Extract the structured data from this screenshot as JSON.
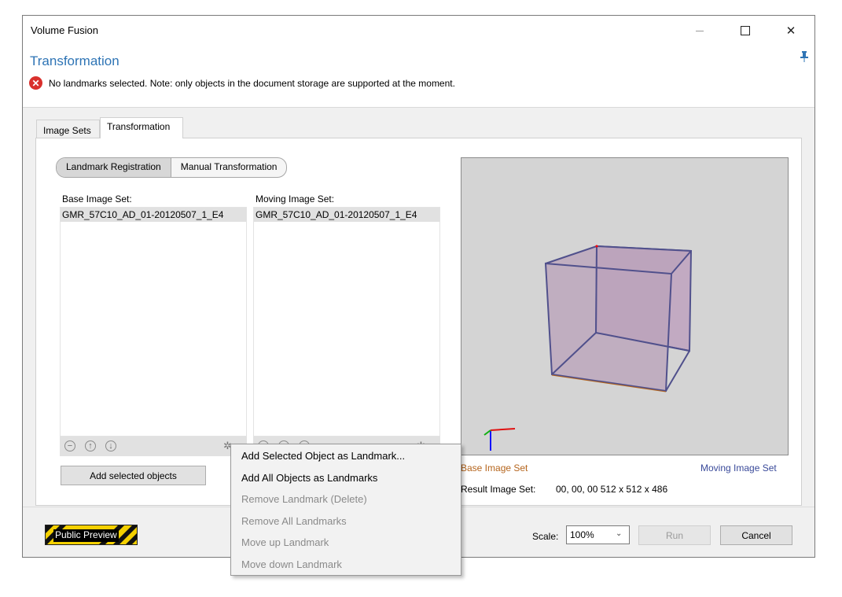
{
  "window": {
    "title": "Volume Fusion",
    "minimize_icon": "minimize-icon",
    "maximize_icon": "maximize-icon",
    "close_icon": "close-icon"
  },
  "header": {
    "title": "Transformation",
    "pin_icon": "pin-icon",
    "error_icon": "error-icon",
    "message": "No landmarks selected. Note: only objects in the document storage are supported at the moment."
  },
  "tabs": [
    {
      "label": "Image Sets",
      "active": false
    },
    {
      "label": "Transformation",
      "active": true
    }
  ],
  "mode_toggle": {
    "options": [
      "Landmark Registration",
      "Manual Transformation"
    ],
    "selected": "Landmark Registration"
  },
  "base": {
    "label": "Base Image Set:",
    "items": [
      "GMR_57C10_AD_01-20120507_1_E4"
    ]
  },
  "moving": {
    "label": "Moving Image Set:",
    "items": [
      "GMR_57C10_AD_01-20120507_1_E4"
    ]
  },
  "list_tools": {
    "remove_icon": "minus-circle-icon",
    "up_icon": "arrow-up-circle-icon",
    "down_icon": "arrow-down-circle-icon",
    "settings_icon": "gear-icon"
  },
  "add_selected_label": "Add selected objects",
  "viewport": {
    "base_label": "Base Image Set",
    "moving_label": "Moving Image Set",
    "result_label": "Result Image Set:",
    "result_value": "00, 00, 00  512 x 512 x 486",
    "base_color": "#b5651d",
    "moving_color": "#3a4a9a"
  },
  "context_menu": [
    {
      "label": "Add Selected Object as Landmark...",
      "enabled": true
    },
    {
      "label": "Add All Objects as Landmarks",
      "enabled": true
    },
    {
      "label": "Remove Landmark  (Delete)",
      "enabled": false
    },
    {
      "label": "Remove All Landmarks",
      "enabled": false
    },
    {
      "label": "Move up Landmark",
      "enabled": false
    },
    {
      "label": "Move down Landmark",
      "enabled": false
    }
  ],
  "footer": {
    "preview_badge": "Public Preview",
    "scale_label": "Scale:",
    "scale_value": "100%",
    "run_label": "Run",
    "cancel_label": "Cancel"
  }
}
